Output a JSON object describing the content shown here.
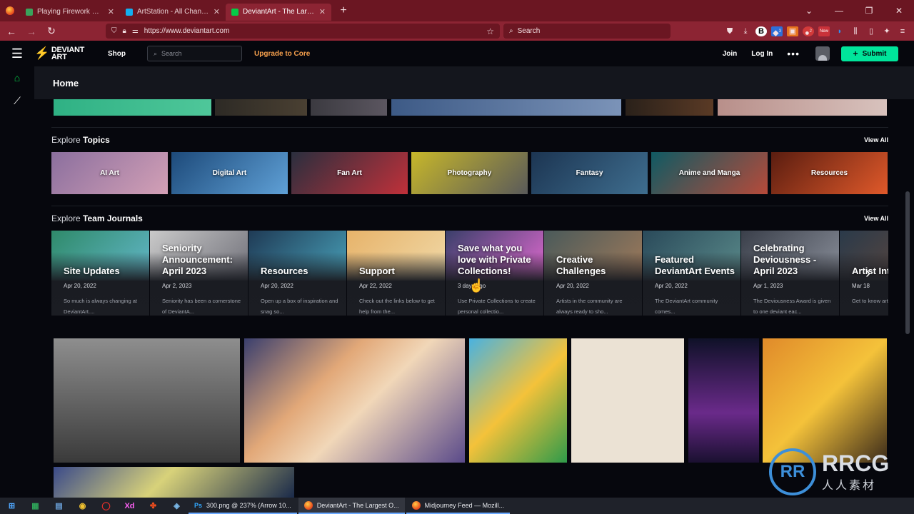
{
  "browser": {
    "tabs": [
      {
        "label": "Playing Firework With Friends S",
        "favicon_color": "#3aa35c",
        "active": false
      },
      {
        "label": "ArtStation - All Channels",
        "favicon_color": "#13aff0",
        "active": false
      },
      {
        "label": "DeviantArt - The Largest Online",
        "favicon_color": "#05cc47",
        "active": true
      }
    ],
    "new_tab_icon": "plus-icon",
    "url": "https://www.deviantart.com",
    "search_placeholder": "Search",
    "badges": {
      "ext1": "3",
      "ext2": "2",
      "ext3": "New"
    }
  },
  "da": {
    "logo_line1": "DEVIANT",
    "logo_line2": "ART",
    "shop": "Shop",
    "search_placeholder": "Search",
    "upgrade": "Upgrade to Core",
    "join": "Join",
    "login": "Log In",
    "more": "•••",
    "submit": "Submit",
    "home": "Home"
  },
  "topics": {
    "heading_prefix": "Explore",
    "heading_strong": "Topics",
    "view_all": "View All",
    "items": [
      {
        "label": "AI Art",
        "colors": [
          "#8b6f9e",
          "#d3a0b6"
        ]
      },
      {
        "label": "Digital Art",
        "colors": [
          "#1d4a7a",
          "#5fa0d6"
        ]
      },
      {
        "label": "Fan Art",
        "colors": [
          "#2a2f3e",
          "#c0303a"
        ]
      },
      {
        "label": "Photography",
        "colors": [
          "#c7b72a",
          "#5a5a5a"
        ]
      },
      {
        "label": "Fantasy",
        "colors": [
          "#1c3552",
          "#3f6e8f"
        ]
      },
      {
        "label": "Anime and Manga",
        "colors": [
          "#0f5a63",
          "#b64a3a"
        ]
      },
      {
        "label": "Resources",
        "colors": [
          "#5a1d10",
          "#e0592a"
        ]
      }
    ]
  },
  "journals": {
    "heading_prefix": "Explore",
    "heading_strong": "Team Journals",
    "view_all": "View All",
    "items": [
      {
        "title": "Site Updates",
        "date": "Apr 20, 2022",
        "desc": "So much is always changing at DeviantArt....",
        "colors": [
          "#2f8a6a",
          "#63b7c9"
        ]
      },
      {
        "title": "Seniority Announcement: April 2023",
        "date": "Apr 2, 2023",
        "desc": "Seniority has been a cornerstone of DeviantA...",
        "colors": [
          "#c9c9c9",
          "#6f6f78"
        ]
      },
      {
        "title": "Resources",
        "date": "Apr 20, 2022",
        "desc": "Open up a box of inspiration and snag so...",
        "colors": [
          "#1f3a55",
          "#48a0b8"
        ]
      },
      {
        "title": "Support",
        "date": "Apr 22, 2022",
        "desc": "Check out the links below to get help from the...",
        "colors": [
          "#e7b36a",
          "#f0d9a8"
        ]
      },
      {
        "title": "Save what you love with Private Collections!",
        "date": "3 days ago",
        "desc": "Use Private Collections to create personal collectio...",
        "colors": [
          "#3a3f6a",
          "#e06ad0"
        ]
      },
      {
        "title": "Creative Challenges",
        "date": "Apr 20, 2022",
        "desc": "Artists in the community are always ready to sho...",
        "colors": [
          "#4a5a5a",
          "#a07a5a"
        ]
      },
      {
        "title": "Featured DeviantArt Events",
        "date": "Apr 20, 2022",
        "desc": "The DeviantArt community comes...",
        "colors": [
          "#2a4a5a",
          "#5a8a8a"
        ]
      },
      {
        "title": "Celebrating Deviousness - April 2023",
        "date": "Apr 1, 2023",
        "desc": "The Deviousness Award is given to one deviant eac...",
        "colors": [
          "#3a3f4a",
          "#8a8f9a"
        ]
      },
      {
        "title": "Artist Inte...",
        "date": "Mar 18",
        "desc": "Get to know artists fro...",
        "colors": [
          "#2a3a4a",
          "#6a4a3a"
        ]
      }
    ]
  },
  "taskbar": {
    "apps": [
      {
        "label": "300.png @ 237% (Arrow 10...",
        "kind": "photoshop",
        "prefix": "Ps"
      },
      {
        "label": "DeviantArt - The Largest O...",
        "kind": "firefox",
        "active": true
      },
      {
        "label": "Midjourney Feed — Mozill...",
        "kind": "firefox"
      }
    ],
    "icons": [
      "windows-start-icon",
      "excel-icon",
      "calculator-icon",
      "chrome-icon",
      "opera-icon",
      "xd-icon",
      "figma-icon",
      "app-icon"
    ],
    "xd_label": "Xd"
  },
  "watermark": {
    "big": "RRCG",
    "small": "人人素材",
    "mark": "RR"
  }
}
